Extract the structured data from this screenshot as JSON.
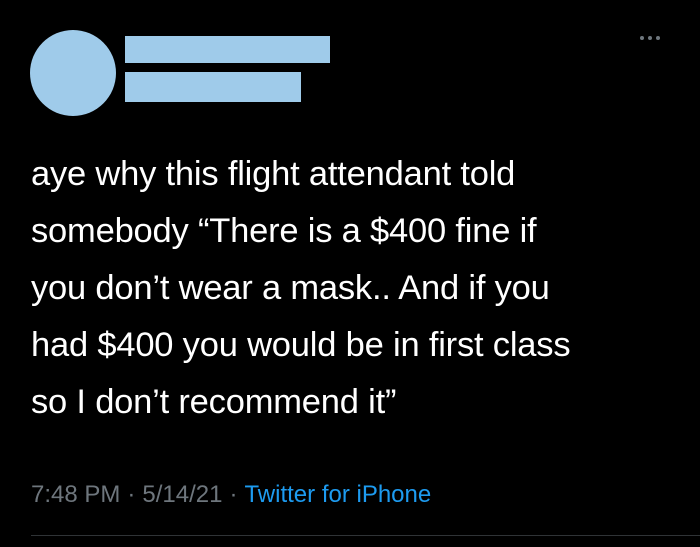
{
  "tweet": {
    "text": "aye why this flight attendant told\nsomebody “There is a $400 fine if\nyou don’t wear a mask.. And if you\nhad $400 you would be in first class\nso I don’t recommend it”",
    "time": "7:48 PM",
    "date": "5/14/21",
    "separator": "·",
    "source": "Twitter for iPhone"
  },
  "colors": {
    "background": "#000000",
    "redaction": "#9fcbea",
    "muted": "#6e767d",
    "link": "#1d9bf0",
    "text": "#ffffff"
  },
  "icons": {
    "more": "more-horizontal-icon"
  }
}
